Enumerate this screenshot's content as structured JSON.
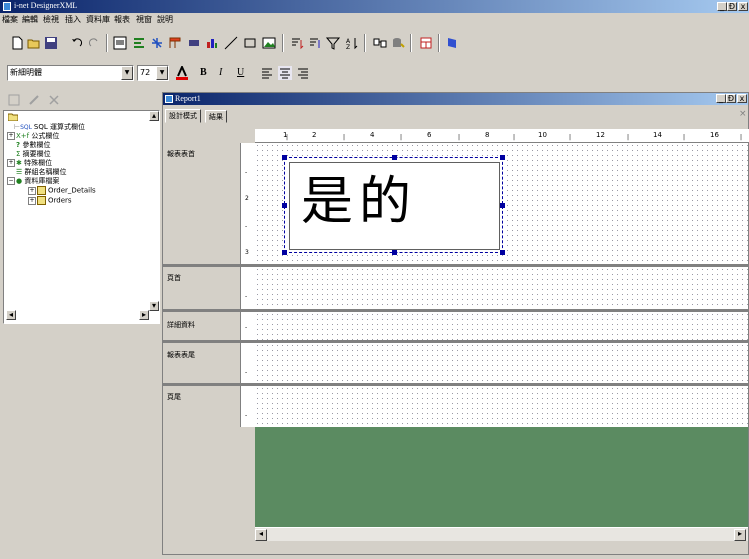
{
  "app": {
    "title": "i-net DesignerXML"
  },
  "window_buttons": {
    "minimize": "_",
    "restore": "Ɖ",
    "close": "x"
  },
  "menu": [
    "檔案",
    "編輯",
    "檢視",
    "插入",
    "資料庫",
    "報表",
    "視窗",
    "說明"
  ],
  "toolbar2": {
    "font_name": "新細明體",
    "font_size": "72",
    "bold": "B",
    "italic": "I",
    "underline": "U"
  },
  "tree": [
    {
      "label": "SQL 運算式欄位",
      "prefix": "SQL"
    },
    {
      "label": "公式欄位",
      "prefix": "X+f"
    },
    {
      "label": "參數欄位",
      "prefix": "?"
    },
    {
      "label": "摘要欄位",
      "prefix": "Σ"
    },
    {
      "label": "特殊欄位",
      "prefix": ""
    },
    {
      "label": "群組名稱欄位",
      "prefix": ""
    },
    {
      "label": "資料庫檔案",
      "prefix": ""
    },
    {
      "label": "Order_Details",
      "prefix": ""
    },
    {
      "label": "Orders",
      "prefix": ""
    }
  ],
  "report": {
    "title": "Report1",
    "tabs": [
      "設計模式",
      "結果"
    ],
    "ruler_numbers": [
      "1",
      "2",
      "4",
      "6",
      "8",
      "10",
      "12",
      "14",
      "16"
    ],
    "sections": [
      "報表表首",
      "頁首",
      "詳細資料",
      "報表表尾",
      "頁尾"
    ],
    "vruler_marks": [
      "-",
      "2",
      "-",
      "3"
    ],
    "text_object": "是的"
  },
  "colors": {
    "titlebar": "#0a246a",
    "empty_area": "#5b8b61",
    "selection": "#0000a0"
  }
}
